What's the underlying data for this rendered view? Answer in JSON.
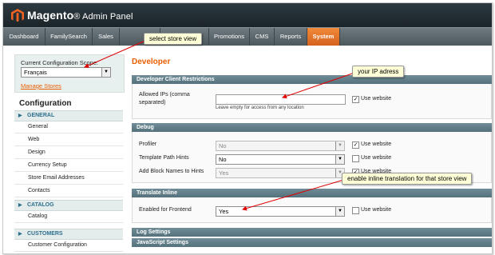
{
  "header": {
    "brand_main": "Magento",
    "brand_sub": "Admin Panel"
  },
  "nav": {
    "items": [
      {
        "label": "Dashboard"
      },
      {
        "label": "FamilySearch"
      },
      {
        "label": "Sales"
      },
      {
        "label": ""
      },
      {
        "label": ""
      },
      {
        "label": "Promotions"
      },
      {
        "label": "CMS"
      },
      {
        "label": "Reports"
      },
      {
        "label": "System"
      }
    ]
  },
  "callouts": {
    "store_view": "select store view",
    "ip": "your IP adress",
    "translate": "enable inline translation for that store view"
  },
  "sidebar": {
    "scope_label": "Current Configuration Scope:",
    "scope_value": "Français",
    "manage_stores": "Manage Stores",
    "config_title": "Configuration",
    "sections": [
      {
        "title": "GENERAL",
        "links": [
          "General",
          "Web",
          "Design",
          "Currency Setup",
          "Store Email Addresses",
          "Contacts"
        ]
      },
      {
        "title": "CATALOG",
        "links": [
          "Catalog"
        ]
      },
      {
        "title": "CUSTOMERS",
        "links": [
          "Customer Configuration"
        ]
      }
    ]
  },
  "main": {
    "title": "Developer",
    "dev_client": {
      "band": "Developer Client Restrictions",
      "field_label_1": "Allowed IPs (comma",
      "field_label_2": "separated)",
      "value": "",
      "note": "Leave empty for access from any location",
      "use_website": "Use website"
    },
    "debug": {
      "band": "Debug",
      "rows": [
        {
          "label": "Profiler",
          "value": "No",
          "use_website": "Use website"
        },
        {
          "label": "Template Path Hints",
          "value": "No",
          "use_website": "Use website"
        },
        {
          "label": "Add Block Names to Hints",
          "value": "Yes",
          "use_website": "Use website"
        }
      ]
    },
    "translate": {
      "band": "Translate Inline",
      "label": "Enabled for Frontend",
      "value": "Yes",
      "use_website": "Use website"
    },
    "log_band": "Log Settings",
    "js_band": "JavaScript Settings"
  }
}
